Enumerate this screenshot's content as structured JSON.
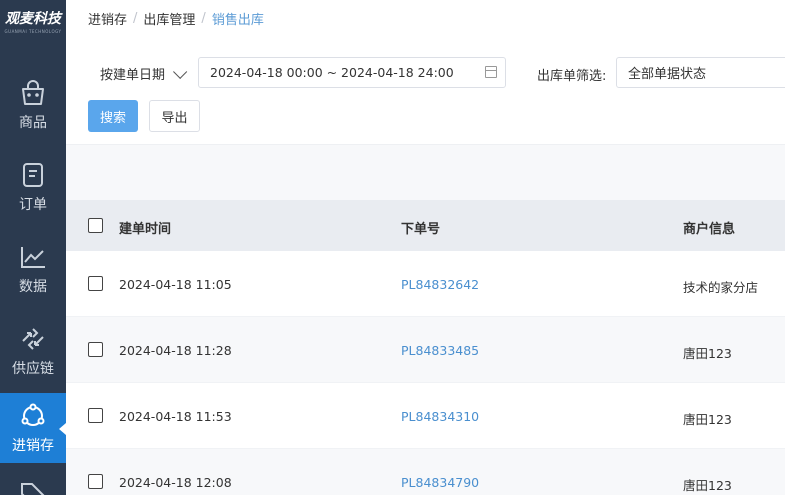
{
  "app": {
    "logo_text": "观麦科技",
    "logo_sub": "GUANMAI TECHNOLOGY"
  },
  "sidebar": {
    "items": [
      {
        "label": "商品",
        "icon": "basket-icon",
        "active": false
      },
      {
        "label": "订单",
        "icon": "order-doc-icon",
        "active": false
      },
      {
        "label": "数据",
        "icon": "chart-line-icon",
        "active": false
      },
      {
        "label": "供应链",
        "icon": "swap-arrows-icon",
        "active": false
      },
      {
        "label": "进销存",
        "icon": "share-cycle-icon",
        "active": true
      }
    ]
  },
  "breadcrumb": [
    "进销存",
    "出库管理",
    "销售出库"
  ],
  "filters": {
    "date_type": "按建单日期",
    "date_range": "2024-04-18 00:00 ~ 2024-04-18 24:00",
    "status_label": "出库单筛选:",
    "status_value": "全部单据状态"
  },
  "buttons": {
    "search": "搜索",
    "export": "导出"
  },
  "table": {
    "columns": [
      "建单时间",
      "下单号",
      "商户信息"
    ],
    "rows": [
      {
        "time": "2024-04-18 11:05",
        "order": "PL84832642",
        "merchant": "技术的家分店"
      },
      {
        "time": "2024-04-18 11:28",
        "order": "PL84833485",
        "merchant": "唐田123"
      },
      {
        "time": "2024-04-18 11:53",
        "order": "PL84834310",
        "merchant": "唐田123"
      },
      {
        "time": "2024-04-18 12:08",
        "order": "PL84834790",
        "merchant": "唐田123"
      }
    ]
  },
  "colors": {
    "sidebar_bg": "#2b3a4f",
    "active_bg": "#1e7fd6",
    "primary": "#5aa6ec",
    "link": "#4a8fcf"
  }
}
